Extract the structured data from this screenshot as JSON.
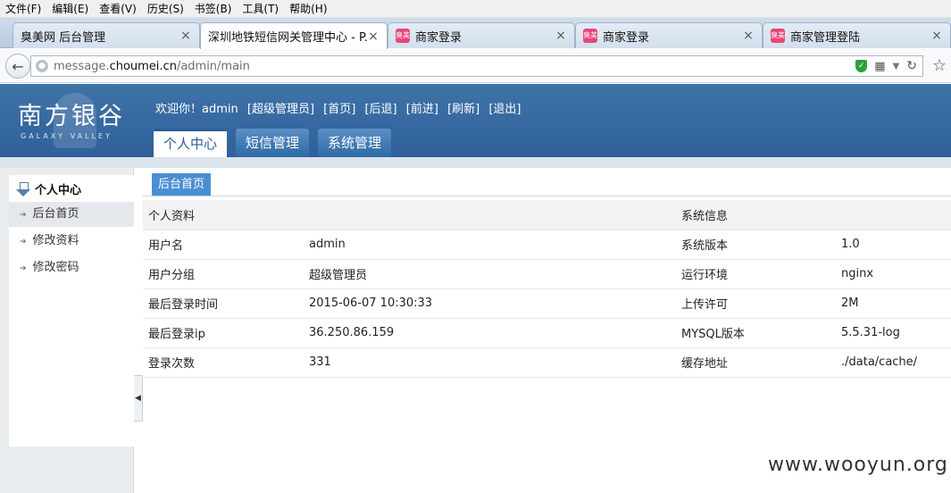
{
  "menubar": {
    "items": [
      "文件(F)",
      "编辑(E)",
      "查看(V)",
      "历史(S)",
      "书签(B)",
      "工具(T)",
      "帮助(H)"
    ]
  },
  "browser_tabs": [
    {
      "title": "臭美网 后台管理",
      "icon": "",
      "active": false
    },
    {
      "title": "深圳地铁短信网关管理中心 - P...",
      "icon": "",
      "active": true
    },
    {
      "title": "商家登录",
      "icon": "臭美",
      "active": false
    },
    {
      "title": "商家登录",
      "icon": "臭美",
      "active": false
    },
    {
      "title": "商家管理登陆",
      "icon": "臭美",
      "active": false
    }
  ],
  "tab_close_glyph": "×",
  "address": {
    "url_prefix": "message.",
    "url_domain": "choumei.cn",
    "url_path": "/admin/main"
  },
  "brand": {
    "name_cn": "南方银谷",
    "name_en": "GALAXY VALLEY"
  },
  "welcome": {
    "greeting": "欢迎你！admin",
    "links": [
      "[超级管理员]",
      "[首页]",
      "[后退]",
      "[前进]",
      "[刷新]",
      "[退出]"
    ]
  },
  "header_tabs": [
    {
      "label": "个人中心",
      "active": true
    },
    {
      "label": "短信管理",
      "active": false
    },
    {
      "label": "系统管理",
      "active": false
    }
  ],
  "sidebar": {
    "heading": "个人中心",
    "items": [
      {
        "label": "后台首页",
        "active": true
      },
      {
        "label": "修改资料",
        "active": false
      },
      {
        "label": "修改密码",
        "active": false
      }
    ],
    "collapse_glyph": "◀"
  },
  "main": {
    "crumb_tab": "后台首页",
    "table": {
      "head": [
        "个人资料",
        "",
        "系统信息",
        ""
      ],
      "rows": [
        [
          "用户名",
          "admin",
          "系统版本",
          "1.0"
        ],
        [
          "用户分组",
          "超级管理员",
          "运行环境",
          "nginx"
        ],
        [
          "最后登录时间",
          "2015-06-07 10:30:33",
          "上传许可",
          "2M"
        ],
        [
          "最后登录ip",
          "36.250.86.159",
          "MYSQL版本",
          "5.5.31-log"
        ],
        [
          "登录次数",
          "331",
          "缓存地址",
          "./data/cache/"
        ]
      ]
    }
  },
  "watermark": "www.wooyun.org",
  "colors": {
    "header_blue": "#3a6ca3",
    "active_tab_text": "#2b5f97",
    "crumb_blue": "#4a8fd4"
  }
}
